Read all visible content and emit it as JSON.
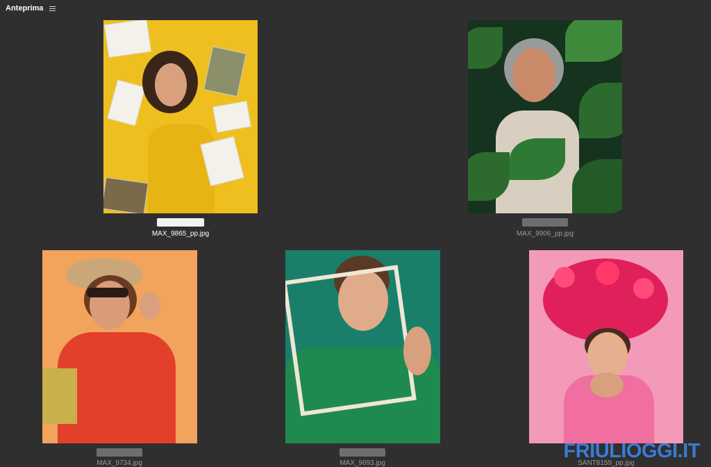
{
  "app": {
    "title": "Anteprima"
  },
  "items": [
    {
      "filename": "MAX_9865_pp.jpg",
      "selected": true
    },
    {
      "filename": "MAX_9906_pp.jpg",
      "selected": false
    },
    {
      "filename": "MAX_9734.jpg",
      "selected": false
    },
    {
      "filename": "MAX_9693.jpg",
      "selected": false
    },
    {
      "filename": "SANT8159_pp.jpg",
      "selected": false
    }
  ],
  "watermark": {
    "text": "FRIULIOGGI.IT",
    "color": "#3a7bd5"
  },
  "colors": {
    "background": "#2f2f2f",
    "caption": "#9a9a9a",
    "caption_selected": "#ffffff"
  },
  "icons": {
    "menu": "hamburger-menu-icon"
  }
}
